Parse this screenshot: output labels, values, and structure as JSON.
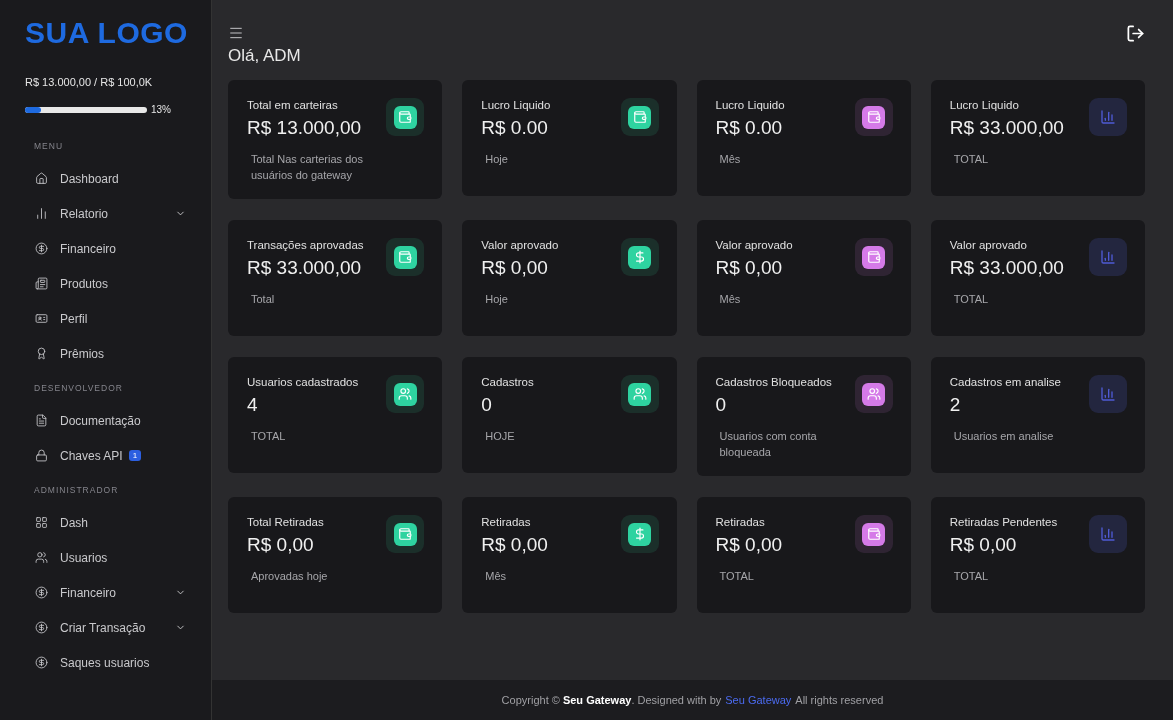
{
  "sidebar": {
    "logo": "SUA LOGO",
    "balance": "R$ 13.000,00 / R$ 100,0K",
    "progress": {
      "level": 0.13,
      "reading": "13%"
    },
    "sections": [
      {
        "title": "MENU",
        "items": [
          {
            "label": "Dashboard",
            "expandable": false
          },
          {
            "label": "Relatorio",
            "expandable": true
          },
          {
            "label": "Financeiro",
            "expandable": false
          },
          {
            "label": "Produtos",
            "expandable": false
          },
          {
            "label": "Perfil",
            "expandable": false
          },
          {
            "label": "Prêmios",
            "expandable": false
          }
        ]
      },
      {
        "title": "DESENVOLVEDOR",
        "items": [
          {
            "label": "Documentação",
            "expandable": false
          },
          {
            "label": "Chaves API",
            "expandable": false,
            "badge": "1"
          }
        ]
      },
      {
        "title": "ADMINISTRADOR",
        "items": [
          {
            "label": "Dash",
            "expandable": false
          },
          {
            "label": "Usuarios",
            "expandable": false
          },
          {
            "label": "Financeiro",
            "expandable": true
          },
          {
            "label": "Criar Transação",
            "expandable": true
          },
          {
            "label": "Saques usuarios",
            "expandable": false
          }
        ]
      }
    ]
  },
  "greeting": "Olá, ADM",
  "card_rows": [
    [
      {
        "title": "Total em carteiras",
        "value": "R$ 13.000,00",
        "note": "Total Nas carterias dos usuários do gateway",
        "color": "#2ed3a0",
        "kind": "filled"
      },
      {
        "title": "Lucro Liquido",
        "value": "R$ 0.00",
        "note": "Hoje",
        "color": "#2ed3a0",
        "kind": "filled"
      },
      {
        "title": "Lucro Liquido",
        "value": "R$ 0.00",
        "note": "Mês",
        "color": "#d57ae8",
        "kind": "filled"
      },
      {
        "title": "Lucro Liquido",
        "value": "R$ 33.000,00",
        "note": "TOTAL",
        "color": "#23263f",
        "kind": "outline"
      }
    ],
    [
      {
        "title": "Transações aprovadas",
        "value": "R$ 33.000,00",
        "note": "Total",
        "color": "#2ed3a0",
        "kind": "filled"
      },
      {
        "title": "Valor aprovado",
        "value": "R$ 0,00",
        "note": "Hoje",
        "color": "#2ed3a0",
        "kind": "filled"
      },
      {
        "title": "Valor aprovado",
        "value": "R$ 0,00",
        "note": "Mês",
        "color": "#d57ae8",
        "kind": "filled"
      },
      {
        "title": "Valor aprovado",
        "value": "R$ 33.000,00",
        "note": "TOTAL",
        "color": "#23263f",
        "kind": "outline"
      }
    ],
    [
      {
        "title": "Usuarios cadastrados",
        "value": "4",
        "note": "TOTAL",
        "color": "#2ed3a0",
        "kind": "filled"
      },
      {
        "title": "Cadastros",
        "value": "0",
        "note": "HOJE",
        "color": "#2ed3a0",
        "kind": "filled"
      },
      {
        "title": "Cadastros Bloqueados",
        "value": "0",
        "note": "Usuarios com conta bloqueada",
        "color": "#d57ae8",
        "kind": "filled"
      },
      {
        "title": "Cadastros em analise",
        "value": "2",
        "note": "Usuarios em analise",
        "color": "#23263f",
        "kind": "outline"
      }
    ],
    [
      {
        "title": "Total Retiradas",
        "value": "R$ 0,00",
        "note": "Aprovadas hoje",
        "color": "#2ed3a0",
        "kind": "filled"
      },
      {
        "title": "Retiradas",
        "value": "R$ 0,00",
        "note": "Mês",
        "color": "#2ed3a0",
        "kind": "filled"
      },
      {
        "title": "Retiradas",
        "value": "R$ 0,00",
        "note": "TOTAL",
        "color": "#d57ae8",
        "kind": "filled"
      },
      {
        "title": "Retiradas Pendentes",
        "value": "R$ 0,00",
        "note": "TOTAL",
        "color": "#23263f",
        "kind": "outline"
      }
    ]
  ],
  "footer": {
    "text": "Copyright © **Seu Gateway**. Designed with by",
    "link": "Seu Gateway",
    "suffix": "All rights reserved"
  }
}
